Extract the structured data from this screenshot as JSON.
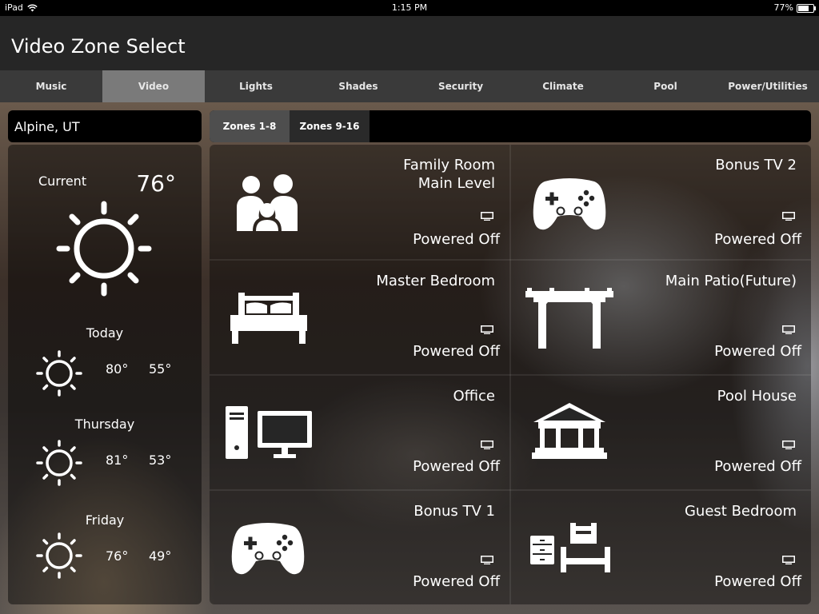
{
  "status_bar": {
    "device": "iPad",
    "time": "1:15 PM",
    "battery": "77%"
  },
  "header": {
    "title": "Video Zone Select"
  },
  "nav": {
    "tabs": [
      {
        "label": "Music"
      },
      {
        "label": "Video"
      },
      {
        "label": "Lights"
      },
      {
        "label": "Shades"
      },
      {
        "label": "Security"
      },
      {
        "label": "Climate"
      },
      {
        "label": "Pool"
      },
      {
        "label": "Power/Utilities"
      }
    ],
    "active": "Video"
  },
  "weather": {
    "location": "Alpine, UT",
    "current": {
      "label": "Current",
      "temp": "76°",
      "icon": "sun-icon"
    },
    "forecast": [
      {
        "day": "Today",
        "high": "80°",
        "low": "55°",
        "icon": "sun-icon"
      },
      {
        "day": "Thursday",
        "high": "81°",
        "low": "53°",
        "icon": "sun-icon"
      },
      {
        "day": "Friday",
        "high": "76°",
        "low": "49°",
        "icon": "sun-icon"
      }
    ]
  },
  "zone_tabs": [
    {
      "label": "Zones 1-8"
    },
    {
      "label": "Zones 9-16"
    }
  ],
  "zones": [
    {
      "name": "Family Room\nMain Level",
      "status": "Powered Off",
      "icon": "family-icon"
    },
    {
      "name": "Bonus TV 2",
      "status": "Powered Off",
      "icon": "game-controller-icon"
    },
    {
      "name": "Master Bedroom",
      "status": "Powered Off",
      "icon": "bed-icon"
    },
    {
      "name": "Main Patio(Future)",
      "status": "Powered Off",
      "icon": "pergola-icon"
    },
    {
      "name": "Office",
      "status": "Powered Off",
      "icon": "computer-icon"
    },
    {
      "name": "Pool House",
      "status": "Powered Off",
      "icon": "gazebo-icon"
    },
    {
      "name": "Bonus TV 1",
      "status": "Powered Off",
      "icon": "game-controller-icon"
    },
    {
      "name": "Guest Bedroom",
      "status": "Powered Off",
      "icon": "guest-bed-icon"
    }
  ],
  "colors": {
    "active_tab": "#7a7a7a",
    "tab_bar": "#3a3a3a",
    "header": "#262626"
  }
}
